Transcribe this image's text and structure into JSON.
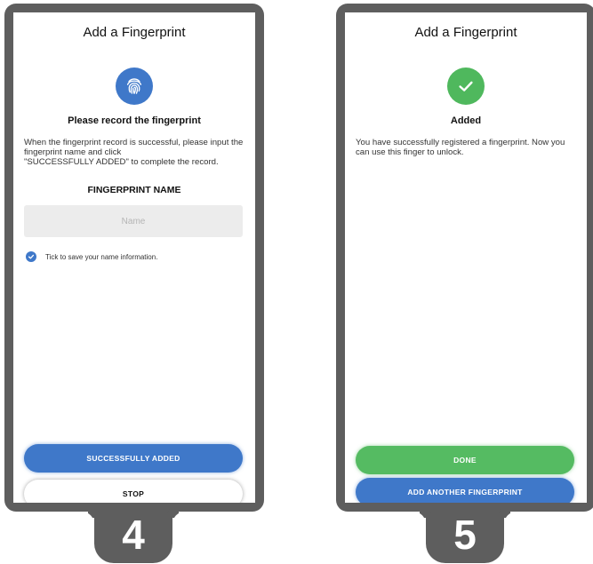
{
  "left_panel": {
    "title": "Add a Fingerprint",
    "icon": "fingerprint-icon",
    "icon_color": "#3f78c9",
    "heading": "Please record the fingerprint",
    "instructions": "When the fingerprint record is successful, please input the fingerprint name and click\n\"SUCCESSFULLY ADDED\"  to complete the record.",
    "field_label": "FINGERPRINT NAME",
    "name_input": {
      "value": "",
      "placeholder": "Name"
    },
    "save_checkbox": {
      "checked": true,
      "label": "Tick to save your name information."
    },
    "primary_button": "SUCCESSFULLY ADDED",
    "secondary_button": "STOP",
    "step_number": "4"
  },
  "right_panel": {
    "title": "Add a Fingerprint",
    "icon": "check-icon",
    "icon_color": "#4fb85d",
    "heading": "Added",
    "message": "You have successfully registered a fingerprint. Now you can use this finger to unlock.",
    "done_button": "DONE",
    "add_another_button": "ADD ANOTHER FINGERPRINT",
    "step_number": "5"
  },
  "colors": {
    "accent_blue": "#3f78c9",
    "success_green": "#55bb62",
    "frame_gray": "#5e5e5e"
  }
}
